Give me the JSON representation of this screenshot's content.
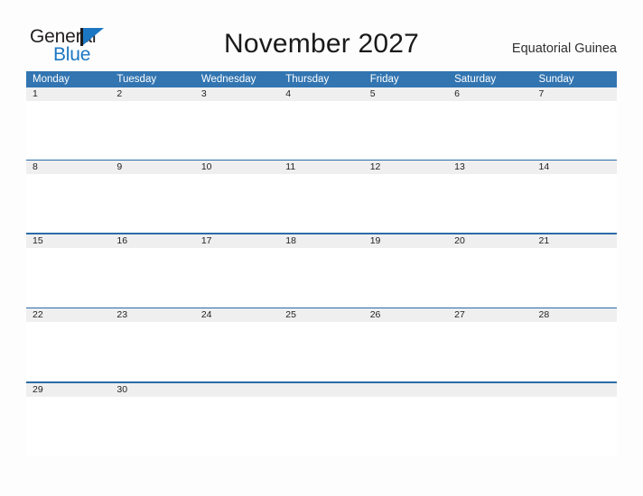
{
  "brand": {
    "name_part1": "General",
    "name_part2": "Blue",
    "flag_icon": "flag-triangle-icon",
    "color_primary": "#1c77c3",
    "color_text": "#231f20"
  },
  "header": {
    "title": "November 2027",
    "region": "Equatorial Guinea"
  },
  "calendar": {
    "month": "November",
    "year": "2027",
    "header_bg": "#3275b1",
    "band_bg": "#efefef",
    "rule_color": "#2b6ca8",
    "weekdays": [
      "Monday",
      "Tuesday",
      "Wednesday",
      "Thursday",
      "Friday",
      "Saturday",
      "Sunday"
    ],
    "weeks": [
      {
        "dates": [
          "1",
          "2",
          "3",
          "4",
          "5",
          "6",
          "7"
        ]
      },
      {
        "dates": [
          "8",
          "9",
          "10",
          "11",
          "12",
          "13",
          "14"
        ]
      },
      {
        "dates": [
          "15",
          "16",
          "17",
          "18",
          "19",
          "20",
          "21"
        ]
      },
      {
        "dates": [
          "22",
          "23",
          "24",
          "25",
          "26",
          "27",
          "28"
        ]
      },
      {
        "dates": [
          "29",
          "30",
          "",
          "",
          "",
          "",
          ""
        ]
      }
    ]
  }
}
